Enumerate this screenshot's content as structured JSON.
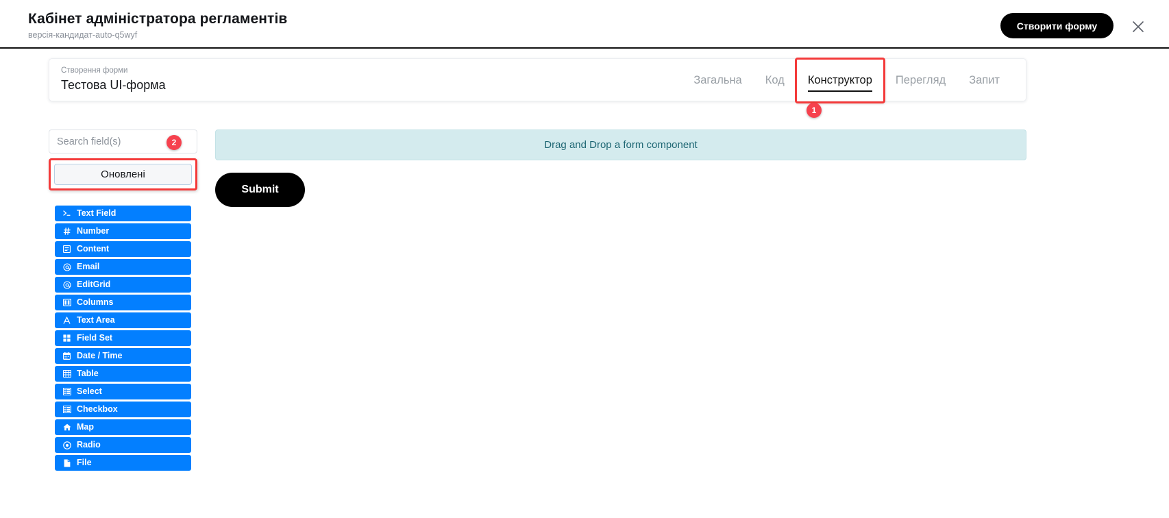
{
  "header": {
    "title": "Кабінет адміністратора регламентів",
    "subtitle": "версія-кандидат-auto-q5wyf",
    "create_button": "Створити форму",
    "close_icon": "close-icon"
  },
  "form_bar": {
    "meta_label": "Створення форми",
    "form_name": "Тестова UI-форма",
    "tabs": [
      {
        "label": "Загальна",
        "active": false
      },
      {
        "label": "Код",
        "active": false
      },
      {
        "label": "Конструктор",
        "active": true
      },
      {
        "label": "Перегляд",
        "active": false
      },
      {
        "label": "Запит",
        "active": false
      }
    ]
  },
  "sidebar": {
    "search": {
      "placeholder": "Search field(s)",
      "value": ""
    },
    "refresh_button": "Оновлені",
    "components": [
      {
        "label": "Text Field",
        "icon": "terminal-icon"
      },
      {
        "label": "Number",
        "icon": "hashtag-icon"
      },
      {
        "label": "Content",
        "icon": "content-icon"
      },
      {
        "label": "Email",
        "icon": "at-sign-icon"
      },
      {
        "label": "EditGrid",
        "icon": "at-sign-icon"
      },
      {
        "label": "Columns",
        "icon": "columns-icon"
      },
      {
        "label": "Text Area",
        "icon": "text-letter-icon"
      },
      {
        "label": "Field Set",
        "icon": "grid-squares-icon"
      },
      {
        "label": "Date / Time",
        "icon": "calendar-icon"
      },
      {
        "label": "Table",
        "icon": "table-icon"
      },
      {
        "label": "Select",
        "icon": "list-icon"
      },
      {
        "label": "Checkbox",
        "icon": "list-icon"
      },
      {
        "label": "Map",
        "icon": "home-icon"
      },
      {
        "label": "Radio",
        "icon": "radio-circle-icon"
      },
      {
        "label": "File",
        "icon": "file-icon"
      }
    ]
  },
  "canvas": {
    "dropzone_text": "Drag and Drop a form component",
    "submit_label": "Submit"
  },
  "annotations": [
    {
      "number": "1"
    },
    {
      "number": "2"
    }
  ],
  "colors": {
    "accent_blue": "#037fff",
    "annotation_red": "#f6414e",
    "highlight_red": "#f43a3a",
    "dropzone_bg": "#d4ebee",
    "dropzone_text": "#1d6673",
    "black": "#000000"
  }
}
